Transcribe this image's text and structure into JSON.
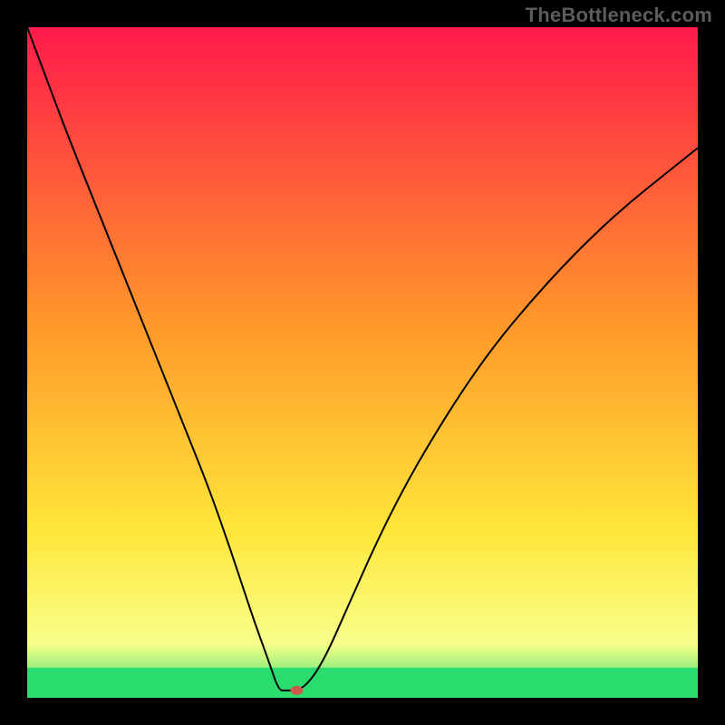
{
  "watermark": "TheBottleneck.com",
  "chart_data": {
    "type": "line",
    "title": "",
    "xlabel": "",
    "ylabel": "",
    "xlim": [
      0,
      100
    ],
    "ylim": [
      0,
      100
    ],
    "gradient_colors_top_to_bottom": [
      "#ff1a4b",
      "#ff9a2a",
      "#ffe63a",
      "#f8ff8a",
      "#2bdc6e"
    ],
    "gradient_stops_pct": [
      0,
      45,
      75,
      92,
      100
    ],
    "series": [
      {
        "name": "curve",
        "x": [
          0,
          3,
          6,
          9,
          12,
          15,
          18,
          21,
          24,
          27,
          30,
          32,
          34,
          36,
          37.5,
          38.5,
          41,
          44,
          48,
          52,
          56,
          60,
          65,
          70,
          75,
          80,
          85,
          90,
          95,
          100
        ],
        "y": [
          100,
          92,
          84,
          76.5,
          69,
          61.5,
          54,
          46.5,
          39,
          31.5,
          23,
          17,
          11,
          5.5,
          1.1,
          1.1,
          1.1,
          5,
          14,
          23,
          31,
          38,
          46,
          53,
          59,
          64.5,
          69.5,
          74,
          78,
          82
        ]
      }
    ],
    "marker": {
      "x": 40.2,
      "y": 1.1,
      "color": "#cc5a4b",
      "rx": 7,
      "ry": 5
    },
    "green_band_top_pct": 95.5,
    "curve_stroke": "#000000",
    "curve_stroke_width": 2
  }
}
